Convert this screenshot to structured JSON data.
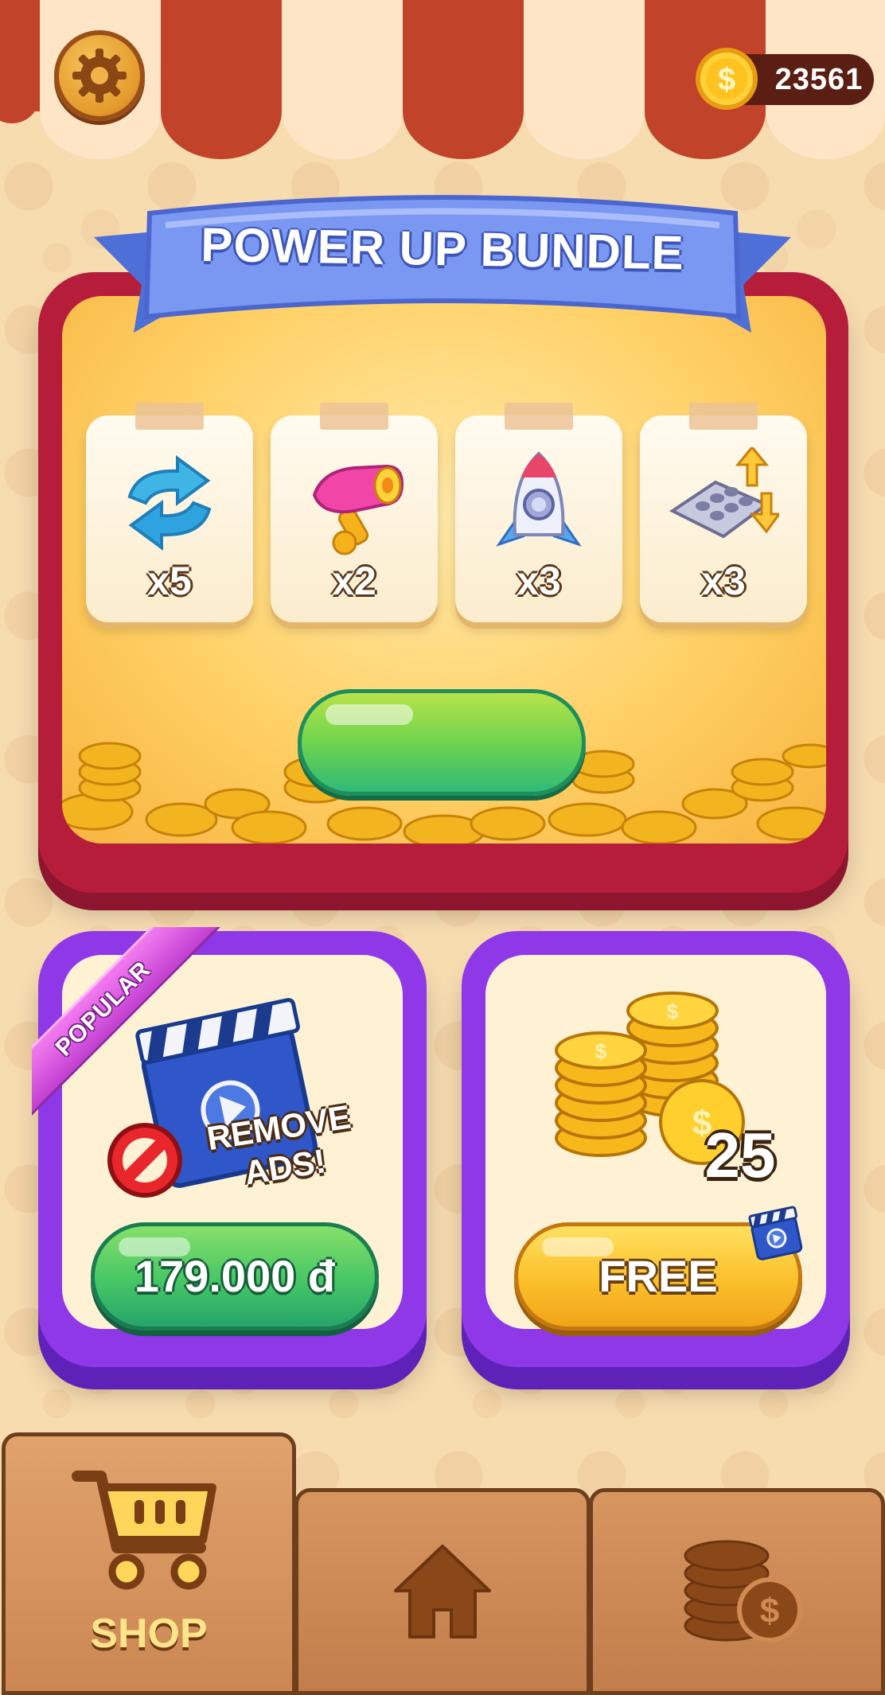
{
  "header": {
    "coin_balance": "23561",
    "settings_icon": "gear-icon",
    "coin_icon": "dollar-coin-icon"
  },
  "bundle": {
    "title": "POWER UP BUNDLE",
    "items": [
      {
        "icon": "shuffle-arrows-icon",
        "quantity": "x5"
      },
      {
        "icon": "magnet-hammer-icon",
        "quantity": "x2"
      },
      {
        "icon": "rocket-icon",
        "quantity": "x3"
      },
      {
        "icon": "swap-tray-icon",
        "quantity": "x3"
      }
    ],
    "buy_button_label": ""
  },
  "offers": {
    "remove_ads": {
      "ribbon": "POPULAR",
      "title_line1": "REMOVE",
      "title_line2": "ADS!",
      "price": "179.000 đ"
    },
    "free_coins": {
      "amount": "25",
      "button_label": "FREE",
      "badge_icon": "video-clapper-icon"
    }
  },
  "nav": {
    "tabs": [
      {
        "label": "SHOP",
        "icon": "cart-icon",
        "active": true
      },
      {
        "label": "",
        "icon": "home-icon",
        "active": false
      },
      {
        "label": "",
        "icon": "coin-stack-icon",
        "active": false
      }
    ]
  },
  "colors": {
    "awning_red": "#c1432a",
    "awning_cream": "#fde5c6",
    "bundle_frame": "#b51d3b",
    "ribbon_blue": "#6f8ff0",
    "offer_purple": "#8f38e8",
    "green_button": "#46c665",
    "yellow_button": "#fbc02a",
    "nav_wood": "#c98851"
  }
}
